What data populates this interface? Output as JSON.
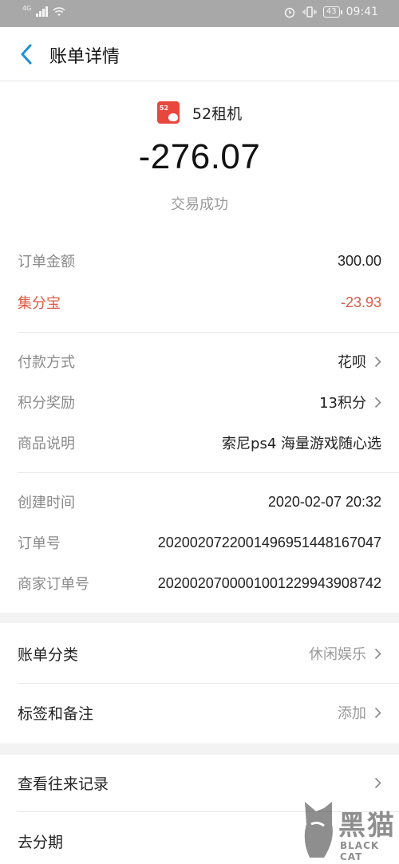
{
  "status_bar": {
    "network": "4G",
    "time": "09:41",
    "battery": "43"
  },
  "nav": {
    "title": "账单详情"
  },
  "merchant": {
    "name": "52租机",
    "logo_text": "52"
  },
  "amount": "-276.07",
  "status": "交易成功",
  "section1": [
    {
      "label": "订单金额",
      "value": "300.00"
    },
    {
      "label": "集分宝",
      "value": "-23.93"
    }
  ],
  "section2": [
    {
      "label": "付款方式",
      "value": "花呗"
    },
    {
      "label": "积分奖励",
      "value": "13积分"
    },
    {
      "label": "商品说明",
      "value": "索尼ps4 海量游戏随心选"
    }
  ],
  "section3": [
    {
      "label": "创建时间",
      "value": "2020-02-07 20:32"
    },
    {
      "label": "订单号",
      "value": "2020020722001496951448167047"
    },
    {
      "label": "商家订单号",
      "value": "2020020700001001229943908742"
    }
  ],
  "category": {
    "label": "账单分类",
    "value": "休闲娱乐"
  },
  "tags": {
    "label": "标签和备注",
    "value": "添加"
  },
  "history": {
    "label": "查看往来记录"
  },
  "installment": {
    "label": "去分期"
  },
  "watermark": {
    "cn": "黑猫",
    "en": "BLACK CAT"
  },
  "colors": {
    "accent_red": "#dd5a45",
    "back_blue": "#1a8fe0",
    "logo_red": "#e8473e"
  }
}
